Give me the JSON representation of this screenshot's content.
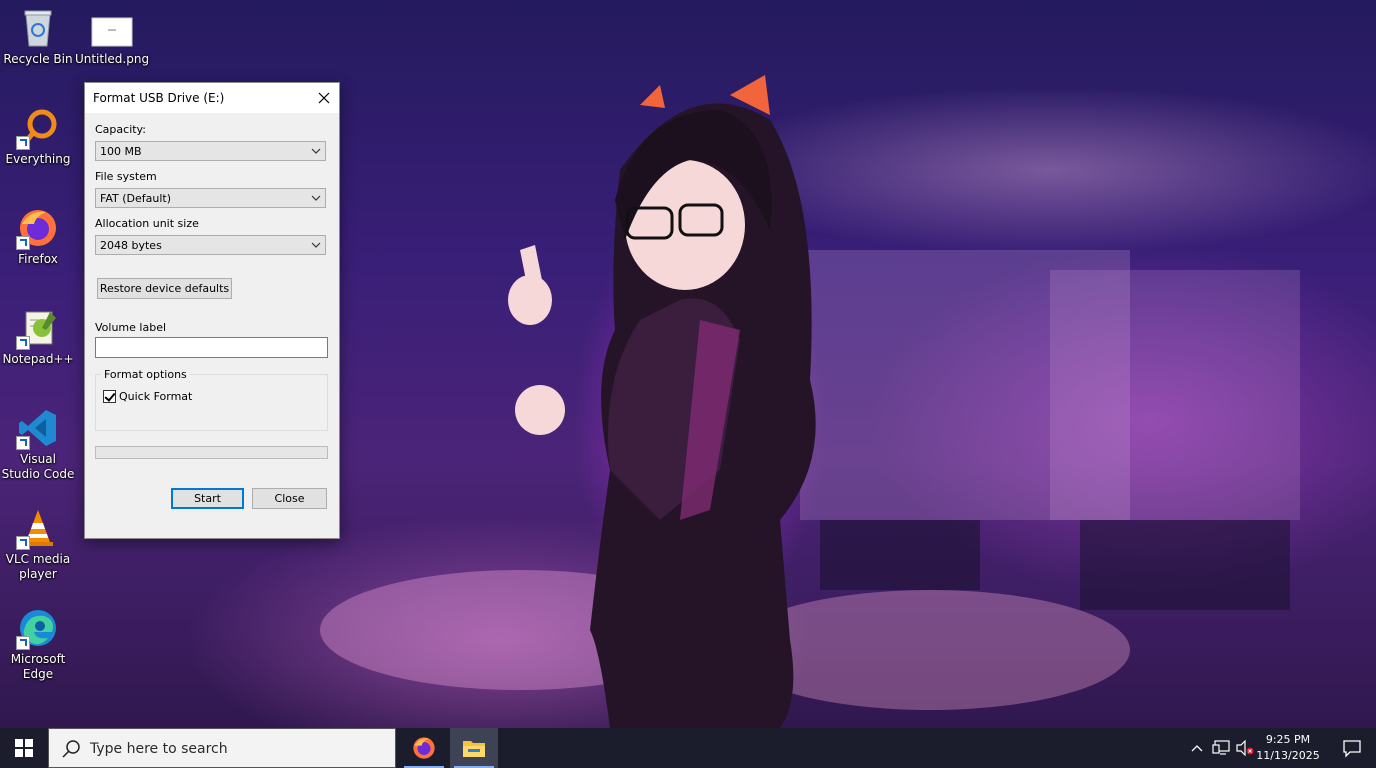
{
  "desktop": {
    "icons": [
      {
        "label": "Recycle Bin"
      },
      {
        "label": "Untitled.png"
      },
      {
        "label": "Everything"
      },
      {
        "label": "Firefox"
      },
      {
        "label": "Notepad++"
      },
      {
        "label": "Visual Studio Code"
      },
      {
        "label": "VLC media player"
      },
      {
        "label": "Microsoft Edge"
      }
    ]
  },
  "dialog": {
    "title": "Format USB Drive (E:)",
    "capacity_label": "Capacity:",
    "capacity_value": "100 MB",
    "filesystem_label": "File system",
    "filesystem_value": "FAT (Default)",
    "allocation_label": "Allocation unit size",
    "allocation_value": "2048 bytes",
    "restore_button": "Restore device defaults",
    "volume_label": "Volume label",
    "volume_value": "",
    "format_options_label": "Format options",
    "quick_format_label": "Quick Format",
    "quick_format_checked": true,
    "progress": 0,
    "start_button": "Start",
    "close_button": "Close"
  },
  "taskbar": {
    "search_placeholder": "Type here to search",
    "time": "9:25 PM",
    "date": "11/13/2025"
  },
  "colors": {
    "taskbar_bg": "#1b1d2c",
    "accent_blue": "#0078d7"
  }
}
